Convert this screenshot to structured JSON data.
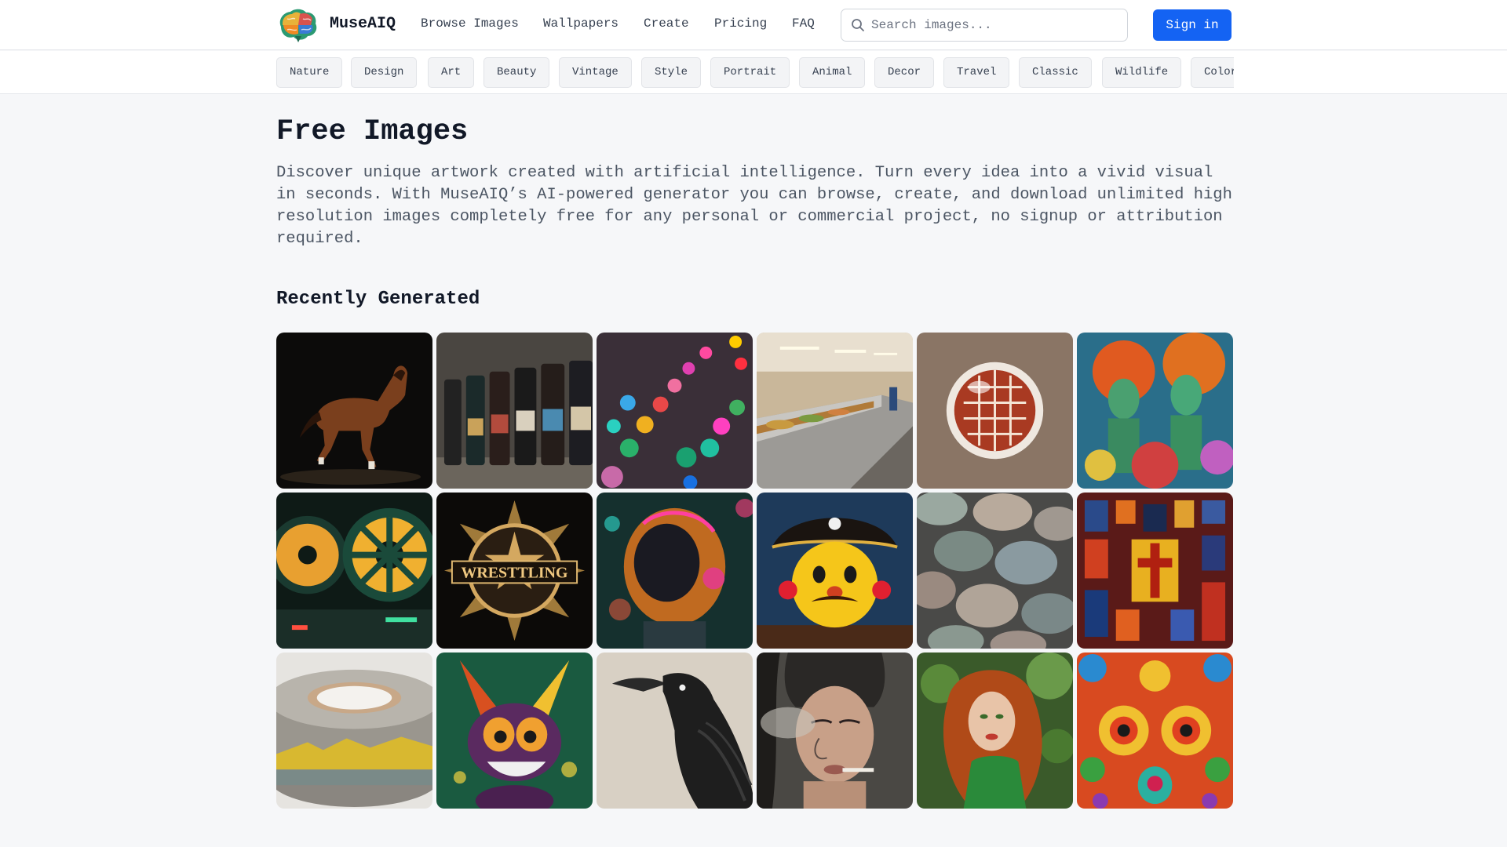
{
  "header": {
    "brand": "MuseAIQ",
    "logo_icon": "brain-logo-icon",
    "nav": [
      "Browse Images",
      "Wallpapers",
      "Create",
      "Pricing",
      "FAQ"
    ],
    "search_placeholder": "Search images...",
    "search_icon": "search-icon",
    "sign_in": "Sign in"
  },
  "categories": [
    "Nature",
    "Design",
    "Art",
    "Beauty",
    "Vintage",
    "Style",
    "Portrait",
    "Animal",
    "Decor",
    "Travel",
    "Classic",
    "Wildlife",
    "Color"
  ],
  "main": {
    "title": "Free Images",
    "description": "Discover unique artwork created with artificial intelligence. Turn every idea into a vivid visual in seconds. With MuseAIQ’s AI-powered generator you can browse, create, and download unlimited high resolution images completely free for any personal or commercial project, no signup or attribution required.",
    "section_title": "Recently Generated"
  },
  "gallery": [
    {
      "name": "horse-image"
    },
    {
      "name": "ink-bottles-image"
    },
    {
      "name": "colorful-beads-image"
    },
    {
      "name": "cafeteria-buffet-image"
    },
    {
      "name": "glass-sphere-image"
    },
    {
      "name": "mermaids-image"
    },
    {
      "name": "film-reels-image"
    },
    {
      "name": "wrestling-emblem-image",
      "text": "WRESTTLING"
    },
    {
      "name": "neon-robot-helmet-image"
    },
    {
      "name": "pirate-emoji-image"
    },
    {
      "name": "stone-discs-image"
    },
    {
      "name": "stained-glass-crosses-image"
    },
    {
      "name": "tape-roll-image"
    },
    {
      "name": "cartoon-rabbit-image"
    },
    {
      "name": "raven-image"
    },
    {
      "name": "smoking-woman-image"
    },
    {
      "name": "redhead-woman-image"
    },
    {
      "name": "folk-art-pattern-image"
    }
  ],
  "colors": {
    "accent": "#1463f3",
    "page_bg": "#f6f7f9",
    "chip_bg": "#f3f4f6"
  }
}
